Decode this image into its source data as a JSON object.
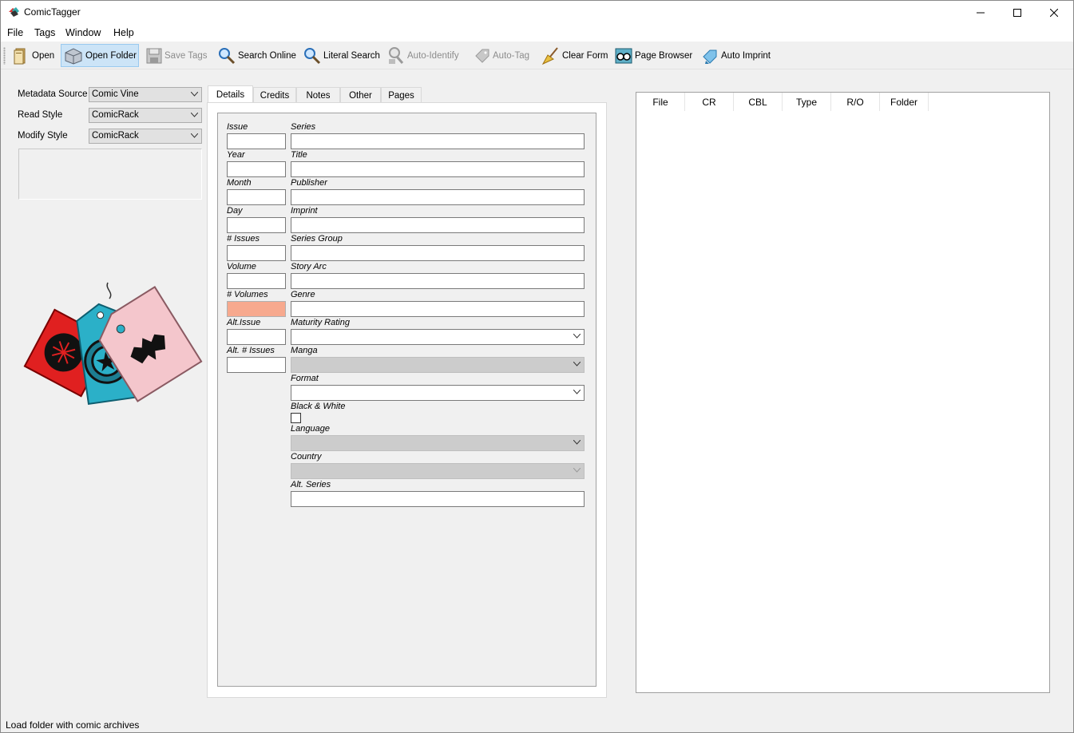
{
  "app": {
    "title": "ComicTagger"
  },
  "menu": {
    "items": [
      "File",
      "Tags",
      "Window",
      "Help"
    ]
  },
  "toolbar": {
    "open": "Open",
    "open_folder": "Open Folder",
    "save_tags": "Save Tags",
    "search_online": "Search Online",
    "literal_search": "Literal Search",
    "auto_identify": "Auto-Identify",
    "auto_tag": "Auto-Tag",
    "clear_form": "Clear Form",
    "page_browser": "Page Browser",
    "auto_imprint": "Auto Imprint"
  },
  "left": {
    "metadata_source_label": "Metadata Source",
    "metadata_source_value": "Comic Vine",
    "read_style_label": "Read Style",
    "read_style_value": "ComicRack",
    "modify_style_label": "Modify Style",
    "modify_style_value": "ComicRack"
  },
  "tabs": [
    "Details",
    "Credits",
    "Notes",
    "Other",
    "Pages"
  ],
  "details": {
    "issue": "Issue",
    "year": "Year",
    "month": "Month",
    "day": "Day",
    "num_issues": "# Issues",
    "volume": "Volume",
    "num_volumes": "# Volumes",
    "alt_issue": "Alt.Issue",
    "alt_num_issues": "Alt. # Issues",
    "series": "Series",
    "title": "Title",
    "publisher": "Publisher",
    "imprint": "Imprint",
    "series_group": "Series Group",
    "story_arc": "Story Arc",
    "genre": "Genre",
    "maturity_rating": "Maturity Rating",
    "manga": "Manga",
    "format": "Format",
    "black_white": "Black & White",
    "language": "Language",
    "country": "Country",
    "alt_series": "Alt. Series"
  },
  "table": {
    "columns": [
      "File",
      "CR",
      "CBL",
      "Type",
      "R/O",
      "Folder"
    ]
  },
  "status": {
    "text": "Load folder with comic archives"
  },
  "colors": {
    "highlight_field": "#f7a98e",
    "toolbar_active": "#cce4f7"
  }
}
